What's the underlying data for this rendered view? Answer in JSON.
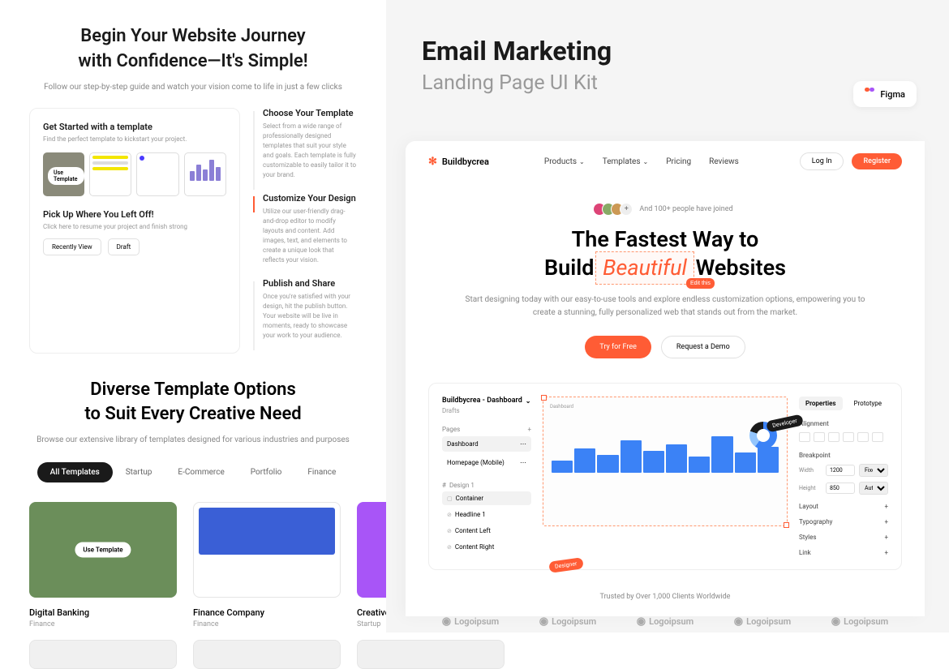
{
  "left": {
    "hero1": {
      "title_line1": "Begin Your Website Journey",
      "title_line2": "with Confidence—It's Simple!",
      "subtitle": "Follow our step-by-step guide and watch your vision come to life in just a few clicks"
    },
    "card": {
      "title": "Get Started with a template",
      "sub": "Find the perfect template to kickstart your project.",
      "use_btn": "Use Template",
      "pickup_title": "Pick Up Where You Left Off!",
      "pickup_sub": "Click here to resume your project and finish strong",
      "btn_recent": "Recently View",
      "btn_draft": "Draft"
    },
    "steps": [
      {
        "title": "Choose Your Template",
        "body": "Select from a wide range of professionally designed templates that suit your style and goals. Each template is fully customizable to easily tailor it to your brand."
      },
      {
        "title": "Customize Your Design",
        "body": "Utilize our user-friendly drag-and-drop editor to modify layouts and content. Add images, text, and elements to create a unique look that reflects your vision."
      },
      {
        "title": "Publish and Share",
        "body": "Once you're satisfied with your design, hit the publish button. Your website will be live in moments, ready to showcase your work to your audience."
      }
    ],
    "hero2": {
      "title_line1": "Diverse Template Options",
      "title_line2": "to Suit Every Creative Need",
      "subtitle": "Browse our extensive library of templates designed for various industries and purposes"
    },
    "tabs": [
      "All Templates",
      "Startup",
      "E-Commerce",
      "Portfolio",
      "Finance"
    ],
    "templates": [
      {
        "name": "Digital Banking",
        "cat": "Finance",
        "overlay": "Use Template"
      },
      {
        "name": "Finance Company",
        "cat": "Finance"
      },
      {
        "name": "Creative",
        "cat": "Startup"
      }
    ]
  },
  "right": {
    "title": "Email Marketing",
    "subtitle": "Landing Page UI Kit",
    "figma": "Figma"
  },
  "app": {
    "brand": "Buildbycrea",
    "nav": [
      "Products",
      "Templates",
      "Pricing",
      "Reviews"
    ],
    "login": "Log In",
    "register": "Register",
    "joined": "And 100+ people have joined",
    "hero_line1": "The Fastest Way to",
    "hero_line2a": "Build",
    "hero_highlight": "Beautiful",
    "hero_edit": "Edit this",
    "hero_line2b": "Websites",
    "hero_sub": "Start designing today with our easy-to-use tools and explore endless customization options, empowering you to create a stunning, fully personalized web that stands out from the market.",
    "try": "Try for Free",
    "demo": "Request a Demo",
    "trusted": "Trusted by Over 1,000 Clients Worldwide",
    "logoipsum": "Logoipsum"
  },
  "canvas": {
    "file": "Buildbycrea - Dashboard",
    "drafts": "Drafts",
    "pages_label": "Pages",
    "pages": [
      "Dashboard",
      "Homepage (Mobile)"
    ],
    "design_label": "Design 1",
    "layers": [
      "Container",
      "Headline 1",
      "Content Left",
      "Content Right"
    ],
    "badge_dev": "Developer",
    "badge_des": "Designer",
    "tabs": [
      "Properties",
      "Prototype"
    ],
    "alignment": "Alignment",
    "breakpoint": "Breakpoint",
    "width_label": "Width",
    "width_val": "1200",
    "width_mode": "Fixed",
    "height_label": "Height",
    "height_val": "850",
    "height_mode": "Auto",
    "sections": [
      "Layout",
      "Typography",
      "Styles",
      "Link"
    ]
  }
}
